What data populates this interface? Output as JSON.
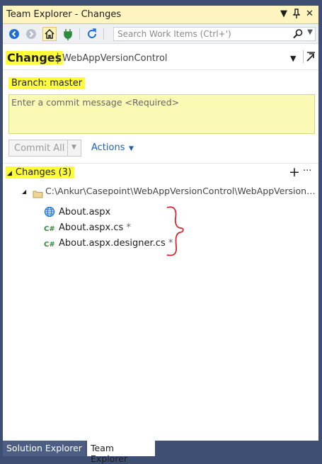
{
  "window": {
    "title": "Team Explorer - Changes",
    "controls": [
      "dropdown-icon",
      "pin-icon",
      "close-icon"
    ]
  },
  "toolbar": {
    "buttons": [
      "back-icon",
      "forward-icon",
      "home-icon",
      "connect-icon",
      "refresh-icon"
    ],
    "search_placeholder": "Search Work Items (Ctrl+')"
  },
  "page": {
    "title": "Changes",
    "project": "WebAppVersionControl"
  },
  "branch": {
    "label": "Branch:",
    "value": "master"
  },
  "commit": {
    "message_placeholder": "Enter a commit message <Required>",
    "commit_all_label": "Commit All",
    "actions_label": "Actions"
  },
  "changes": {
    "header": "Changes (3)",
    "folder_path": "C:\\Ankur\\Casepoint\\WebAppVersionControl\\WebAppVersionControl",
    "files": [
      {
        "name": "About.aspx",
        "suffix": "",
        "icon": "web-file-icon"
      },
      {
        "name": "About.aspx.cs",
        "suffix": "*",
        "icon": "csharp-file-icon"
      },
      {
        "name": "About.aspx.designer.cs",
        "suffix": "*",
        "icon": "csharp-file-icon"
      }
    ]
  },
  "tabs": [
    {
      "label": "Solution Explorer",
      "active": false
    },
    {
      "label": "Team Explorer",
      "active": true
    }
  ],
  "colors": {
    "highlight": "#fffd38",
    "commit_box": "#fafab4",
    "title_bar": "#fdf4bf",
    "accent_blue": "#1e5fb4",
    "frame": "#3f4f73",
    "annotation": "#e0202a"
  }
}
